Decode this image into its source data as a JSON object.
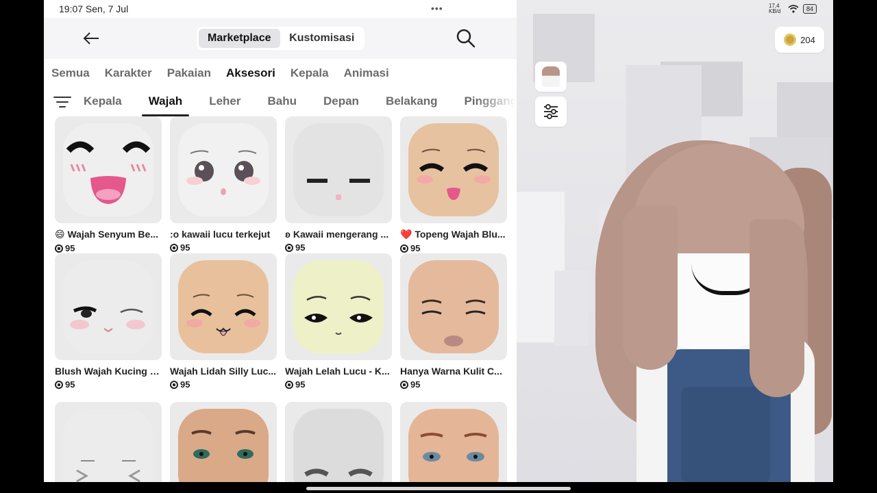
{
  "status_bar": {
    "time_date": "19:07  Sen, 7 Jul",
    "center_dots": "•••",
    "network_speed": "17,4 KB/d",
    "battery": "84"
  },
  "header": {
    "segments": [
      {
        "label": "Marketplace",
        "active": true
      },
      {
        "label": "Kustomisasi",
        "active": false
      }
    ]
  },
  "robux": {
    "balance": "204"
  },
  "category_tabs": [
    {
      "label": "Semua",
      "active": false
    },
    {
      "label": "Karakter",
      "active": false
    },
    {
      "label": "Pakaian",
      "active": false
    },
    {
      "label": "Aksesori",
      "active": true
    },
    {
      "label": "Kepala",
      "active": false
    },
    {
      "label": "Animasi",
      "active": false
    }
  ],
  "sub_tabs": [
    {
      "label": "Kepala",
      "active": false
    },
    {
      "label": "Wajah",
      "active": true
    },
    {
      "label": "Leher",
      "active": false
    },
    {
      "label": "Bahu",
      "active": false
    },
    {
      "label": "Depan",
      "active": false
    },
    {
      "label": "Belakang",
      "active": false
    },
    {
      "label": "Pinggang",
      "active": false
    }
  ],
  "items": [
    {
      "title": "😄 Wajah Senyum Be...",
      "price": "95",
      "skin": "#efefef"
    },
    {
      "title": ":o kawaii lucu terkejut",
      "price": "95",
      "skin": "#f1f1f1"
    },
    {
      "title": "ʚ Kawaii mengerang ...",
      "price": "95",
      "skin": "#e3e3e3"
    },
    {
      "title": "❤️ Topeng Wajah Blu...",
      "price": "95",
      "skin": "#e7c2a0"
    },
    {
      "title": "Blush Wajah Kucing S...",
      "price": "95",
      "skin": "#ececec"
    },
    {
      "title": "Wajah Lidah Silly Luc...",
      "price": "95",
      "skin": "#e9c09c"
    },
    {
      "title": "Wajah Lelah Lucu - K...",
      "price": "95",
      "skin": "#eef0c8"
    },
    {
      "title": "Hanya Warna Kulit C...",
      "price": "95",
      "skin": "#e4b99c"
    },
    {
      "title": "",
      "price": "",
      "skin": "#ececec"
    },
    {
      "title": "",
      "price": "",
      "skin": "#d9a988"
    },
    {
      "title": "",
      "price": "",
      "skin": "#dcdcdc"
    },
    {
      "title": "",
      "price": "",
      "skin": "#e4b596"
    }
  ],
  "icons": {
    "back": "arrow-left-icon",
    "search": "search-icon",
    "filter": "filter-icon",
    "robux": "robux-icon",
    "settings": "sliders-icon"
  }
}
